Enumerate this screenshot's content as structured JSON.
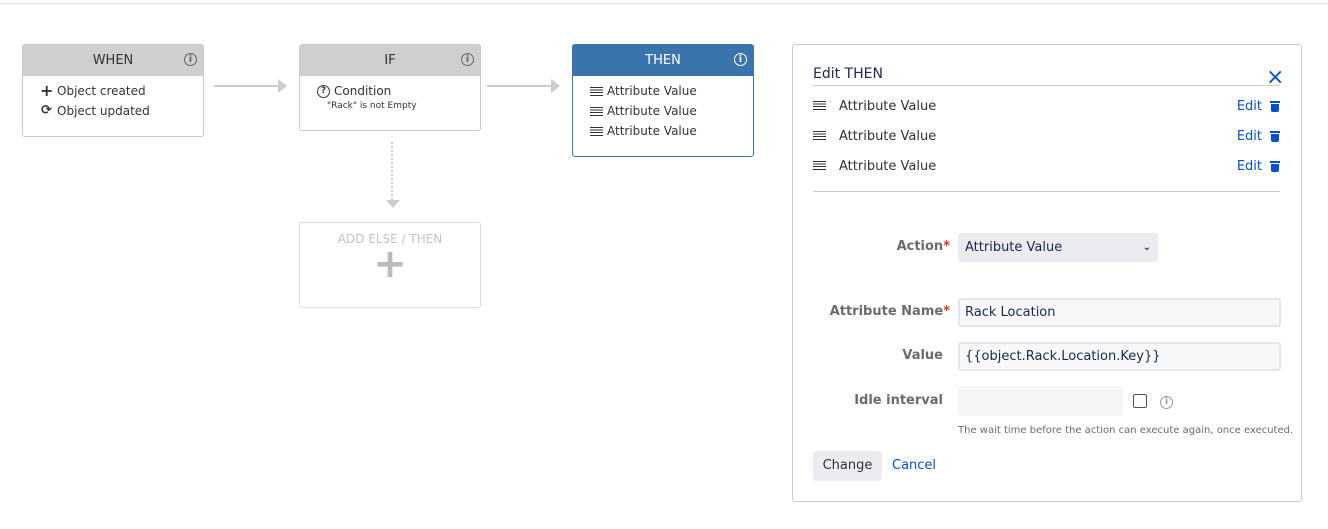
{
  "flow": {
    "when": {
      "title": "WHEN",
      "items": [
        {
          "icon": "plus-icon",
          "label": "Object created"
        },
        {
          "icon": "refresh-icon",
          "label": "Object updated"
        }
      ]
    },
    "if": {
      "title": "IF",
      "condition_label": "Condition",
      "condition_detail": "\"Rack\" is not Empty"
    },
    "then": {
      "title": "THEN",
      "items": [
        "Attribute Value",
        "Attribute Value",
        "Attribute Value"
      ]
    },
    "add_else": {
      "label": "ADD ELSE / THEN",
      "icon": "+"
    }
  },
  "panel": {
    "title": "Edit THEN",
    "close": "×",
    "actions": [
      {
        "label": "Attribute Value",
        "edit": "Edit"
      },
      {
        "label": "Attribute Value",
        "edit": "Edit"
      },
      {
        "label": "Attribute Value",
        "edit": "Edit"
      }
    ],
    "form": {
      "action_label": "Action",
      "action_value": "Attribute Value",
      "attr_name_label": "Attribute Name",
      "attr_name_value": "Rack Location",
      "value_label": "Value",
      "value_value": "{{object.Rack.Location.Key}}",
      "idle_label": "Idle interval",
      "idle_value": "",
      "idle_help": "The wait time before the action can execute again, once executed.",
      "required_mark": "*"
    },
    "change_button": "Change",
    "cancel_link": "Cancel"
  },
  "colors": {
    "accent": "#3b73ad",
    "link": "#0052cc",
    "required": "#de350b"
  }
}
